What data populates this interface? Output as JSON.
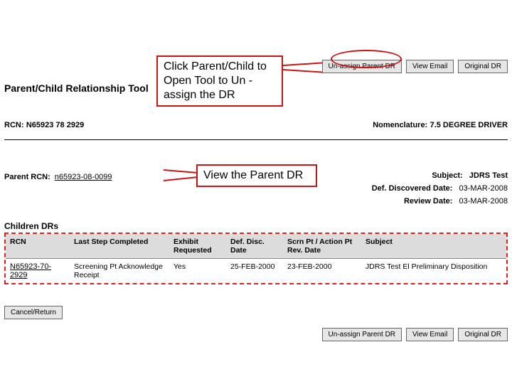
{
  "callout1": "Click Parent/Child to Open Tool to Un -assign the DR",
  "callout2": "View the Parent DR",
  "page_title": "Parent/Child Relationship Tool",
  "top_buttons": {
    "unassign": "Un-assign Parent DR",
    "view_email": "View Email",
    "original_dr": "Original DR"
  },
  "rcn": {
    "label": "RCN:",
    "value": "N65923 78 2929"
  },
  "nomenclature": {
    "label": "Nomenclature:",
    "value": "7.5 DEGREE DRIVER"
  },
  "parent_rcn": {
    "label": "Parent RCN:",
    "value": "n65923-08-0099"
  },
  "subject": {
    "label": "Subject:",
    "value": "JDRS Test"
  },
  "def_date": {
    "label": "Def. Discovered Date:",
    "value": "03-MAR-2008"
  },
  "review_date": {
    "label": "Review Date:",
    "value": "03-MAR-2008"
  },
  "children_head": "Children DRs",
  "table": {
    "headers": {
      "rcn": "RCN",
      "step": "Last Step Completed",
      "exhibit": "Exhibit Requested",
      "def_disc": "Def. Disc. Date",
      "scrn": "Scrn Pt / Action Pt Rev. Date",
      "subject": "Subject"
    },
    "row": {
      "rcn": "N65923-70-2929",
      "step": "Screening Pt Acknowledge Receipt",
      "exhibit": "Yes",
      "def_disc": "25-FEB-2000",
      "scrn": "23-FEB-2000",
      "subject": "JDRS Test El Preliminary Disposition"
    }
  },
  "cancel_return": "Cancel/Return",
  "bottom_buttons": {
    "unassign": "Un-assign Parent DR",
    "view_email": "View Email",
    "original_dr": "Original DR"
  }
}
